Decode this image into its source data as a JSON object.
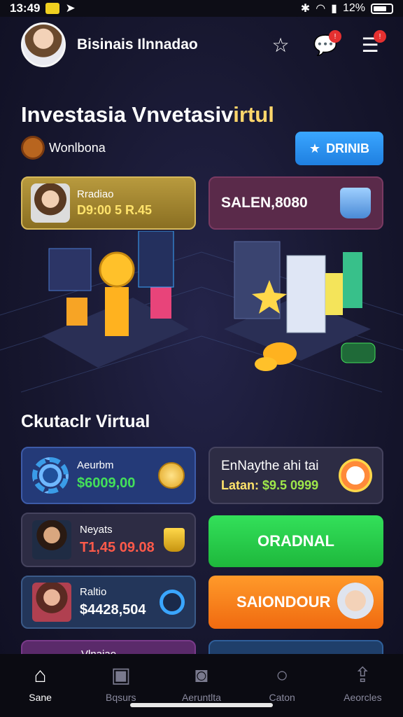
{
  "status": {
    "time": "13:49",
    "battery": "12%"
  },
  "header": {
    "title": "Bisinais Ilnnadao",
    "icons": [
      "star-icon",
      "chat-icon",
      "menu-icon"
    ]
  },
  "hero": {
    "title_main": "Investasia Vnvetasiv",
    "title_accent": "irtul",
    "subtitle": "Wonlbona",
    "button_label": "DRINIB"
  },
  "top_cards": {
    "left": {
      "label": "Rradiao",
      "value": "D9:00 5 R.45"
    },
    "right": {
      "label": "SALEN,8080"
    }
  },
  "section": {
    "title": "Ckutaclr Virtual"
  },
  "tiles": {
    "t1": {
      "label": "Aeurbm",
      "value": "$6009,00"
    },
    "t2": {
      "label": "EnNaythe ahi tai",
      "prefix": "Latan: ",
      "value": "$9.5 0999"
    },
    "t3": {
      "label": "Neyats",
      "value": "T1,45 09.08"
    },
    "t5": {
      "label": "Raltio",
      "value": "$4428,504"
    },
    "t7": {
      "label": "Vlnaiao"
    }
  },
  "buttons": {
    "green": "ORADNAL",
    "orange": "SAIONDOUR"
  },
  "tabs": [
    {
      "label": "Sane",
      "icon": "home-icon",
      "active": true
    },
    {
      "label": "Bqsurs",
      "icon": "bag-icon",
      "active": false
    },
    {
      "label": "Aeruntlta",
      "icon": "camera-icon",
      "active": false
    },
    {
      "label": "Caton",
      "icon": "search-icon",
      "active": false
    },
    {
      "label": "Aeorcles",
      "icon": "share-icon",
      "active": false
    }
  ],
  "colors": {
    "accent_blue": "#3aa6ff",
    "green": "#33e05a",
    "orange": "#f06a10",
    "gold": "#b89a3e"
  }
}
